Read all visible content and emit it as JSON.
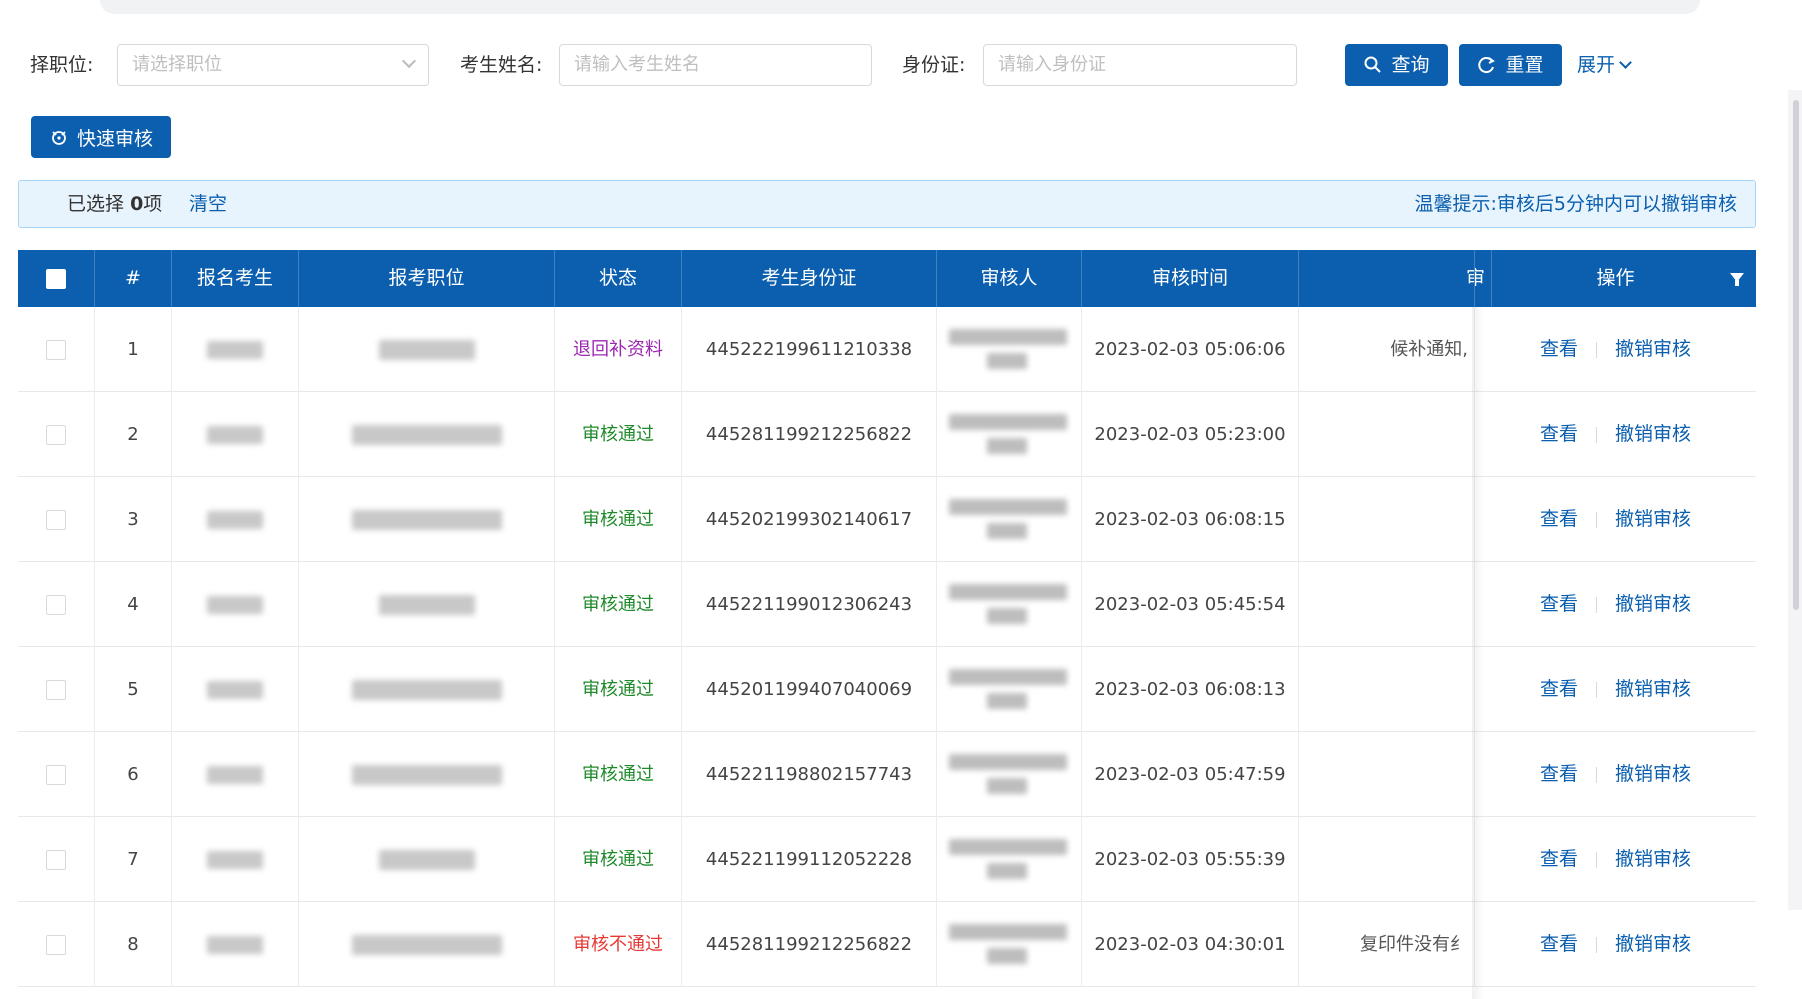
{
  "filters": {
    "position_label": "择职位:",
    "position_placeholder": "请选择职位",
    "name_label": "考生姓名:",
    "name_placeholder": "请输入考生姓名",
    "id_label": "身份证:",
    "id_placeholder": "请输入身份证",
    "search_label": "查询",
    "reset_label": "重置",
    "expand_label": "展开"
  },
  "quick_review_label": "快速审核",
  "info": {
    "selected_prefix": "已选择",
    "selected_count": "0",
    "selected_suffix": "项",
    "clear_label": "清空",
    "tip": "温馨提示:审核后5分钟内可以撤销审核"
  },
  "table": {
    "headers": [
      "#",
      "报名考生",
      "报考职位",
      "状态",
      "考生身份证",
      "审核人",
      "审核时间",
      "审",
      "操作"
    ],
    "rows": [
      {
        "index": "1",
        "status": "退回补资料",
        "status_type": "return",
        "id_card": "445222199611210338",
        "time": "2023-02-03 05:06:06",
        "remark": "候补通知,"
      },
      {
        "index": "2",
        "status": "审核通过",
        "status_type": "pass",
        "id_card": "445281199212256822",
        "time": "2023-02-03 05:23:00",
        "remark": ""
      },
      {
        "index": "3",
        "status": "审核通过",
        "status_type": "pass",
        "id_card": "445202199302140617",
        "time": "2023-02-03 06:08:15",
        "remark": ""
      },
      {
        "index": "4",
        "status": "审核通过",
        "status_type": "pass",
        "id_card": "445221199012306243",
        "time": "2023-02-03 05:45:54",
        "remark": ""
      },
      {
        "index": "5",
        "status": "审核通过",
        "status_type": "pass",
        "id_card": "445201199407040069",
        "time": "2023-02-03 06:08:13",
        "remark": ""
      },
      {
        "index": "6",
        "status": "审核通过",
        "status_type": "pass",
        "id_card": "445221198802157743",
        "time": "2023-02-03 05:47:59",
        "remark": ""
      },
      {
        "index": "7",
        "status": "审核通过",
        "status_type": "pass",
        "id_card": "445221199112052228",
        "time": "2023-02-03 05:55:39",
        "remark": ""
      },
      {
        "index": "8",
        "status": "审核不通过",
        "status_type": "fail",
        "id_card": "445281199212256822",
        "time": "2023-02-03 04:30:01",
        "remark": "复印件没有纟"
      }
    ],
    "action_view": "查看",
    "action_revoke": "撤销审核"
  },
  "colors": {
    "primary": "#0b5fae",
    "status_return": "#9c27b0",
    "status_pass": "#1e8a2a",
    "status_fail": "#e53935"
  }
}
